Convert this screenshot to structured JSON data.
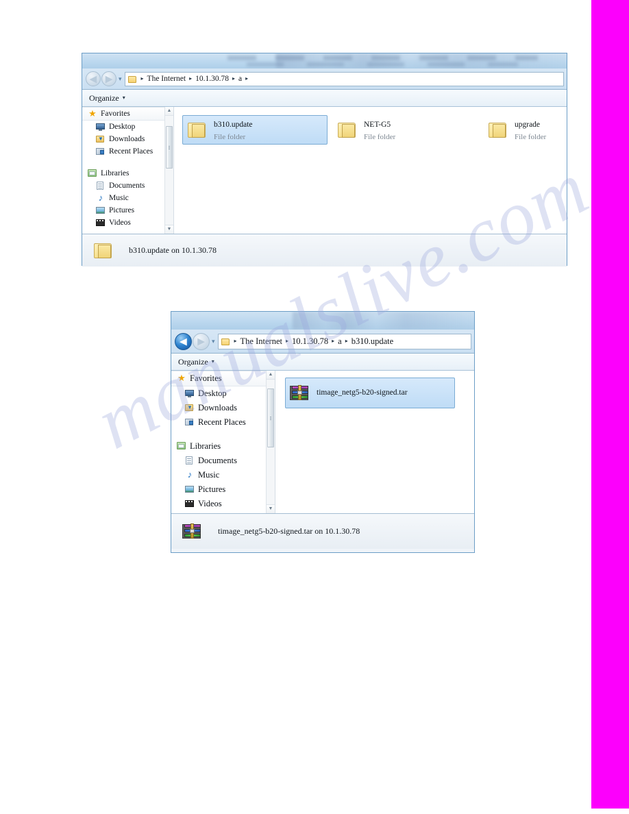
{
  "page": {
    "watermark_text": "manualslive.com",
    "magenta_band_color": "#fc00fc"
  },
  "window_one": {
    "nav": {
      "back_label": "◀",
      "forward_label": "▶",
      "recent_pages_caret": "▾"
    },
    "breadcrumb": {
      "folder_icon": "folder-icon",
      "separator": "▸",
      "items": [
        "The Internet",
        "10.1.30.78",
        "a"
      ],
      "trailing_separator": "▸"
    },
    "toolbar": {
      "organize_label": "Organize",
      "caret": "▾"
    },
    "sidebar": {
      "groups": [
        {
          "header": {
            "label": "Favorites",
            "icon": "star-icon"
          },
          "items": [
            {
              "label": "Desktop",
              "icon": "desktop-icon"
            },
            {
              "label": "Downloads",
              "icon": "downloads-icon"
            },
            {
              "label": "Recent Places",
              "icon": "recent-places-icon"
            }
          ]
        },
        {
          "header": {
            "label": "Libraries",
            "icon": "libraries-icon"
          },
          "items": [
            {
              "label": "Documents",
              "icon": "documents-icon"
            },
            {
              "label": "Music",
              "icon": "music-icon"
            },
            {
              "label": "Pictures",
              "icon": "pictures-icon"
            },
            {
              "label": "Videos",
              "icon": "videos-icon"
            }
          ]
        }
      ],
      "scroll_up": "▲",
      "scroll_down": "▼"
    },
    "items": [
      {
        "name": "b310.update",
        "type": "File folder",
        "selected": true
      },
      {
        "name": "NET-G5",
        "type": "File folder",
        "selected": false
      },
      {
        "name": "upgrade",
        "type": "File folder",
        "selected": false
      }
    ],
    "status": {
      "icon": "folder-icon",
      "text": "b310.update on 10.1.30.78"
    }
  },
  "window_two": {
    "nav": {
      "back_label": "◀",
      "forward_label": "▶",
      "recent_pages_caret": "▾"
    },
    "breadcrumb": {
      "folder_icon": "folder-icon",
      "separator": "▸",
      "items": [
        "The Internet",
        "10.1.30.78",
        "a",
        "b310.update"
      ],
      "trailing_separator": ""
    },
    "toolbar": {
      "organize_label": "Organize",
      "caret": "▾"
    },
    "sidebar": {
      "groups": [
        {
          "header": {
            "label": "Favorites",
            "icon": "star-icon"
          },
          "items": [
            {
              "label": "Desktop",
              "icon": "desktop-icon"
            },
            {
              "label": "Downloads",
              "icon": "downloads-icon"
            },
            {
              "label": "Recent Places",
              "icon": "recent-places-icon"
            }
          ]
        },
        {
          "header": {
            "label": "Libraries",
            "icon": "libraries-icon"
          },
          "items": [
            {
              "label": "Documents",
              "icon": "documents-icon"
            },
            {
              "label": "Music",
              "icon": "music-icon"
            },
            {
              "label": "Pictures",
              "icon": "pictures-icon"
            },
            {
              "label": "Videos",
              "icon": "videos-icon"
            }
          ]
        }
      ],
      "scroll_up": "▲",
      "scroll_down": "▼"
    },
    "items": [
      {
        "name": "timage_netg5-b20-signed.tar",
        "icon": "archive-icon",
        "selected": true
      }
    ],
    "status": {
      "icon": "archive-icon",
      "text": "timage_netg5-b20-signed.tar on 10.1.30.78"
    }
  }
}
